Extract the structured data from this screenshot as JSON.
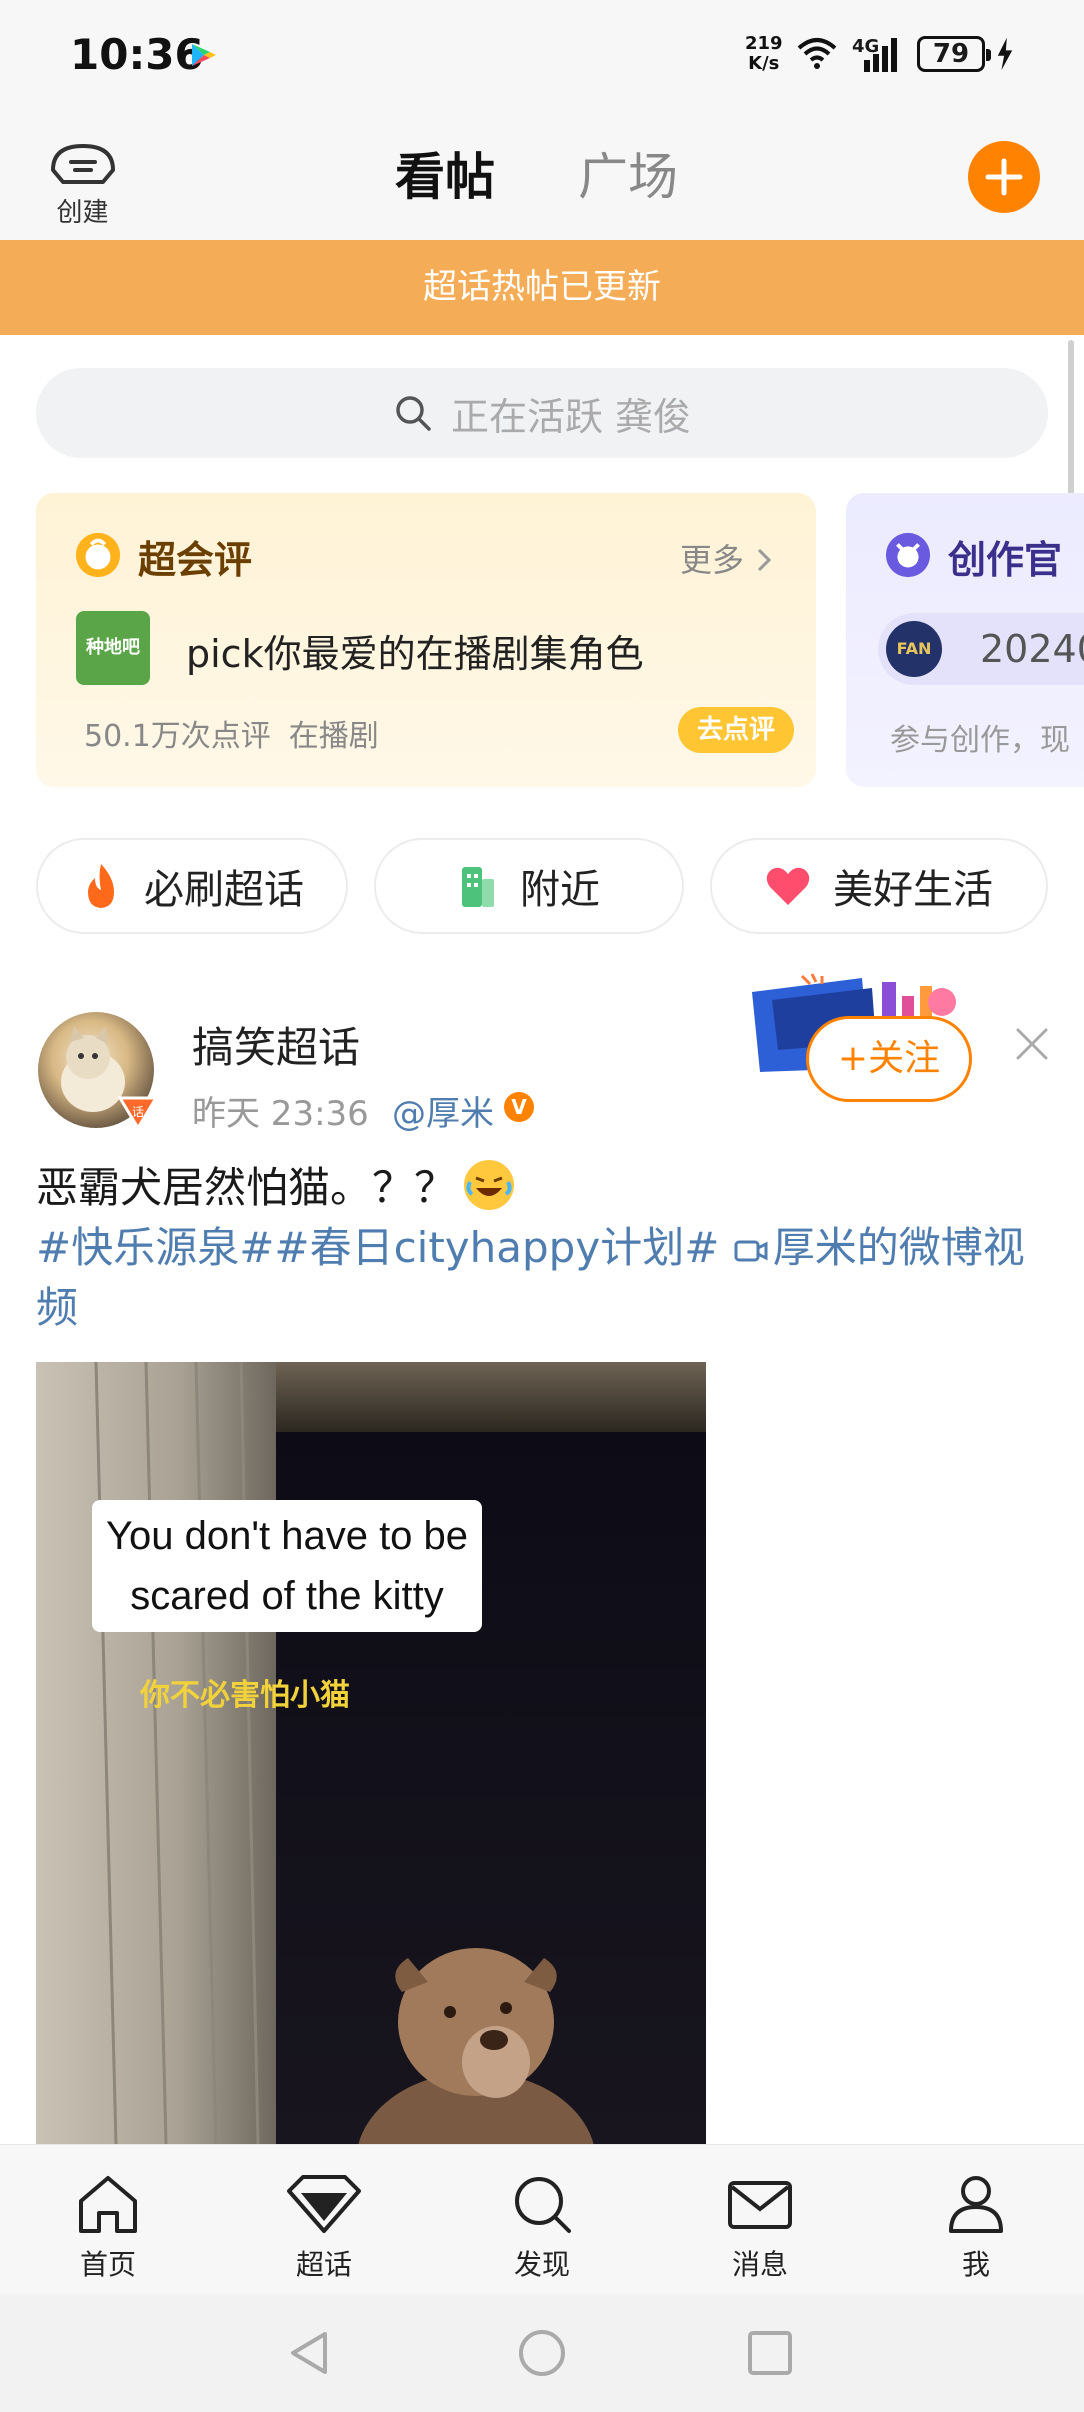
{
  "status_bar": {
    "time": "10:36",
    "net_speed": "219\nK/s",
    "signal_label": "4G",
    "battery": "79",
    "icons": [
      "app-store-icon",
      "wifi-icon",
      "signal-icon",
      "battery-icon",
      "charging-icon"
    ]
  },
  "header": {
    "create_label": "创建",
    "tabs": [
      {
        "label": "看帖",
        "active": true
      },
      {
        "label": "广场",
        "active": false
      }
    ],
    "accent_color": "#ff8200"
  },
  "banner": {
    "text": "超话热帖已更新",
    "color": "#f5ac56"
  },
  "search": {
    "placeholder": "正在活跃 龚俊"
  },
  "cards": [
    {
      "title": "超会评",
      "more": "更多",
      "thumb_text": "种地吧",
      "line": "pick你最爱的在播剧集角色",
      "meta": [
        "50.1万次点评",
        "在播剧"
      ],
      "action": "去点评"
    },
    {
      "title": "创作官",
      "number": "20240",
      "meta": "参与创作，现"
    }
  ],
  "chips": [
    {
      "label": "必刷超话",
      "icon": "flame-icon"
    },
    {
      "label": "附近",
      "icon": "building-icon"
    },
    {
      "label": "美好生活",
      "icon": "heart-icon"
    }
  ],
  "post": {
    "name": "搞笑超话",
    "time": "昨天 23:36",
    "author": "@厚米",
    "follow_label": "+关注",
    "text": "恶霸犬居然怕猫。？？",
    "tags": "#快乐源泉##春日cityhappy计划# ",
    "video_link": "厚米的微博视频",
    "video": {
      "subtitle_en_line1": "You don't have to be",
      "subtitle_en_line2": "scared of the kitty",
      "subtitle_cn": "你不必害怕小猫"
    }
  },
  "bottom_nav": [
    {
      "label": "首页",
      "icon": "home-icon"
    },
    {
      "label": "超话",
      "icon": "diamond-icon"
    },
    {
      "label": "发现",
      "icon": "search-icon"
    },
    {
      "label": "消息",
      "icon": "mail-icon"
    },
    {
      "label": "我",
      "icon": "person-icon"
    }
  ]
}
